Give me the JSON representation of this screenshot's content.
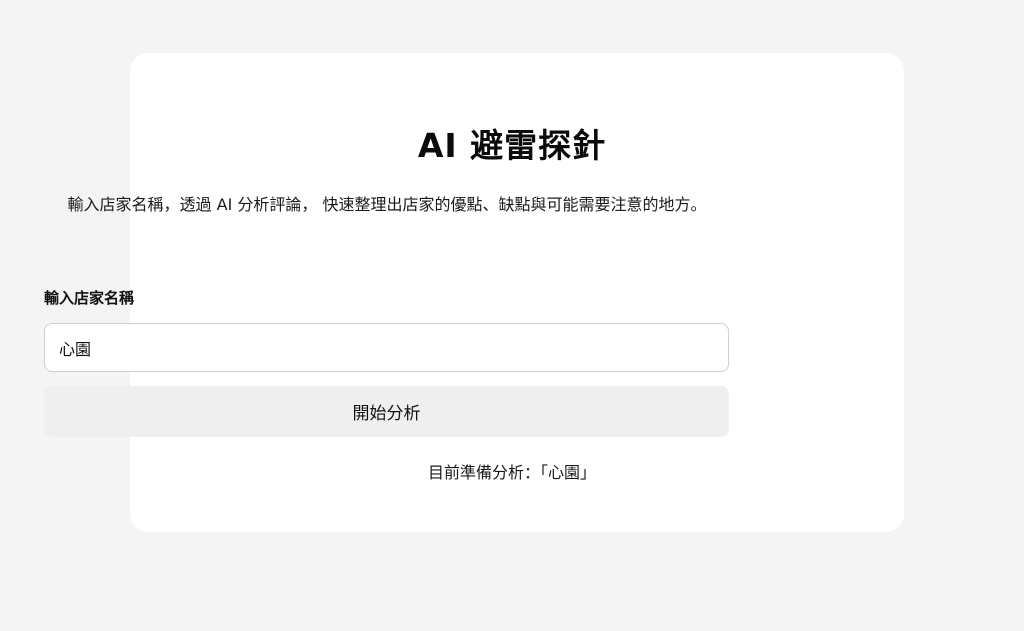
{
  "app": {
    "title": "AI 避雷探針",
    "description": "輸入店家名稱，透過 AI 分析評論， 快速整理出店家的優點、缺點與可能需要注意的地方。"
  },
  "form": {
    "label": "輸入店家名稱",
    "input_value": "心園",
    "submit_label": "開始分析"
  },
  "status": {
    "text": "目前準備分析：「心園」"
  }
}
